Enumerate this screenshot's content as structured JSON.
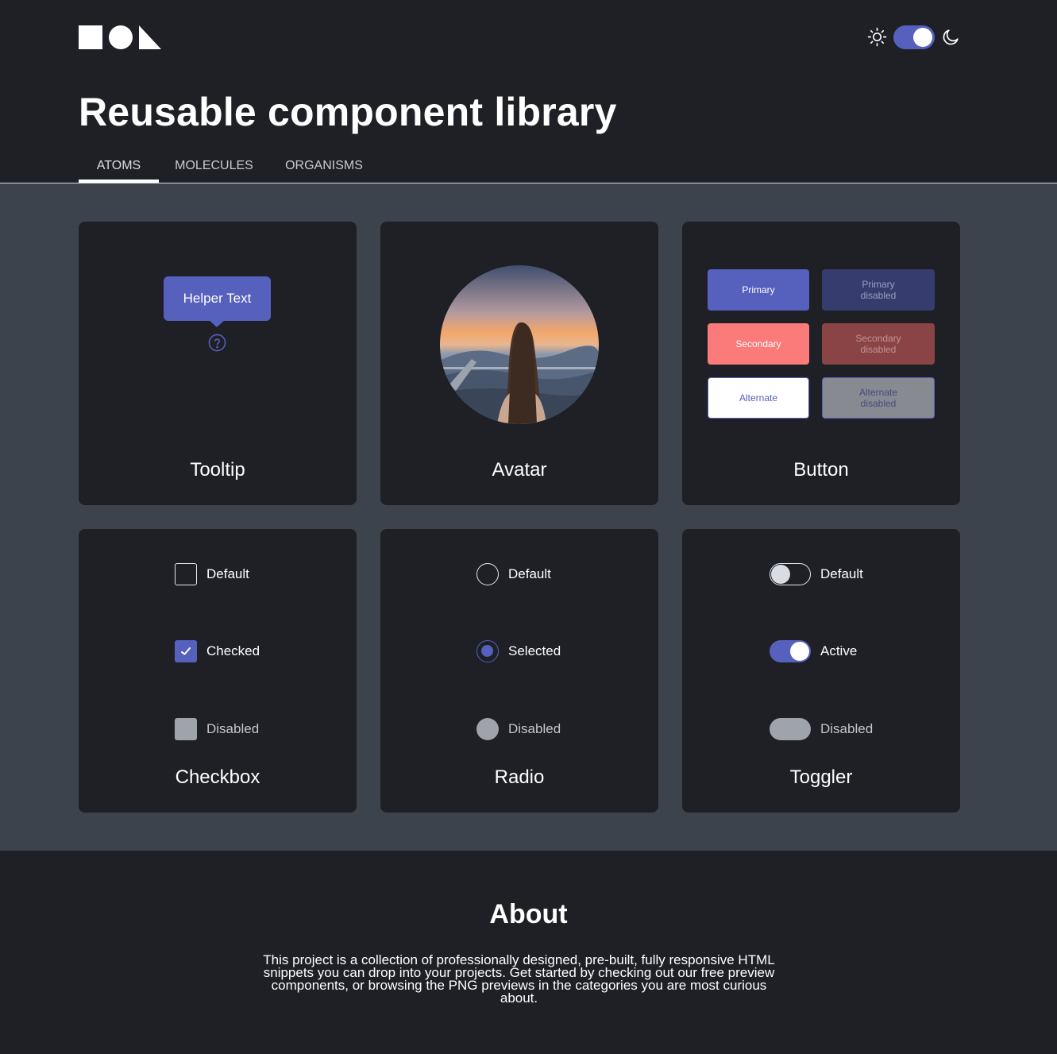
{
  "header": {
    "title": "Reusable component library",
    "theme_toggle": {
      "state": "on",
      "left_icon": "sun-icon",
      "right_icon": "moon-icon"
    }
  },
  "tabs": [
    {
      "label": "ATOMS",
      "active": true
    },
    {
      "label": "MOLECULES",
      "active": false
    },
    {
      "label": "ORGANISMS",
      "active": false
    }
  ],
  "cards": {
    "tooltip": {
      "title": "Tooltip",
      "helper_text": "Helper Text",
      "icon": "help-icon"
    },
    "avatar": {
      "title": "Avatar"
    },
    "button": {
      "title": "Button",
      "buttons": [
        {
          "label": "Primary"
        },
        {
          "label": "Primary\ndisabled"
        },
        {
          "label": "Secondary"
        },
        {
          "label": "Secondary\ndisabled"
        },
        {
          "label": "Alternate"
        },
        {
          "label": "Alternate\ndisabled"
        }
      ]
    },
    "checkbox": {
      "title": "Checkbox",
      "items": [
        "Default",
        "Checked",
        "Disabled"
      ]
    },
    "radio": {
      "title": "Radio",
      "items": [
        "Default",
        "Selected",
        "Disabled"
      ]
    },
    "toggler": {
      "title": "Toggler",
      "items": [
        "Default",
        "Active",
        "Disabled"
      ]
    }
  },
  "footer": {
    "title": "About",
    "text": "This project is a collection of professionally designed, pre-built, fully responsive HTML snippets you can drop into your projects. Get started by checking out our free preview components, or browsing the PNG previews in the categories you are most curious about."
  },
  "colors": {
    "accent": "#5660bd",
    "secondary": "#fb7a7a",
    "background_dark": "#1e2026",
    "background_main": "#3d434c"
  }
}
